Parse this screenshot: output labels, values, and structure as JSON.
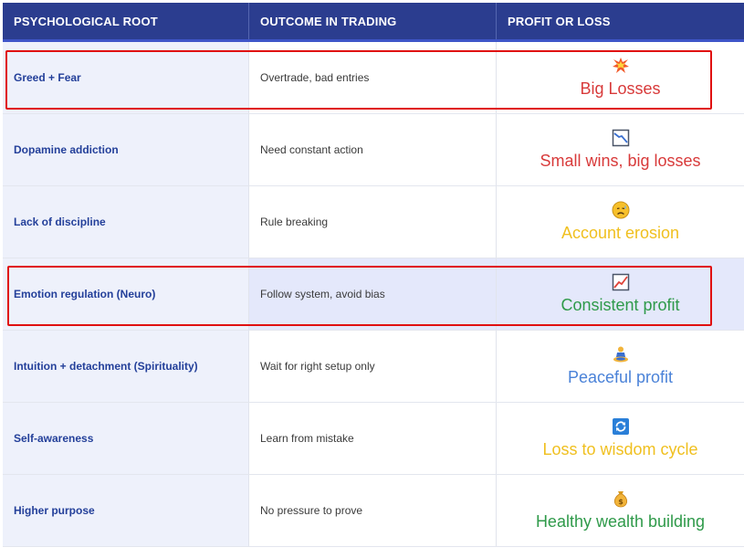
{
  "headers": [
    "PSYCHOLOGICAL ROOT",
    "OUTCOME IN TRADING",
    "PROFIT OR LOSS"
  ],
  "rows": [
    {
      "root": "Greed + Fear",
      "outcome": "Overtrade, bad entries",
      "result": "Big Losses",
      "icon": "collision-icon",
      "color": "#d83a3a"
    },
    {
      "root": "Dopamine addiction",
      "outcome": "Need constant action",
      "result": "Small wins, big losses",
      "icon": "chart-decreasing-icon",
      "color": "#d83a3a"
    },
    {
      "root": "Lack of discipline",
      "outcome": "Rule breaking",
      "result": "Account erosion",
      "icon": "sad-face-icon",
      "color": "#f0c020"
    },
    {
      "root": "Emotion regulation (Neuro)",
      "outcome": "Follow system, avoid bias",
      "result": "Consistent profit",
      "icon": "chart-increasing-icon",
      "color": "#2f9a4a"
    },
    {
      "root": "Intuition + detachment (Spirituality)",
      "outcome": "Wait for right setup only",
      "result": "Peaceful profit",
      "icon": "meditation-icon",
      "color": "#4a82d8"
    },
    {
      "root": "Self-awareness",
      "outcome": "Learn from mistake",
      "result": "Loss to wisdom cycle",
      "icon": "cycle-arrows-icon",
      "color": "#f0c020"
    },
    {
      "root": "Higher purpose",
      "outcome": "No pressure to prove",
      "result": "Healthy wealth building",
      "icon": "money-bag-icon",
      "color": "#2f9a4a"
    }
  ]
}
